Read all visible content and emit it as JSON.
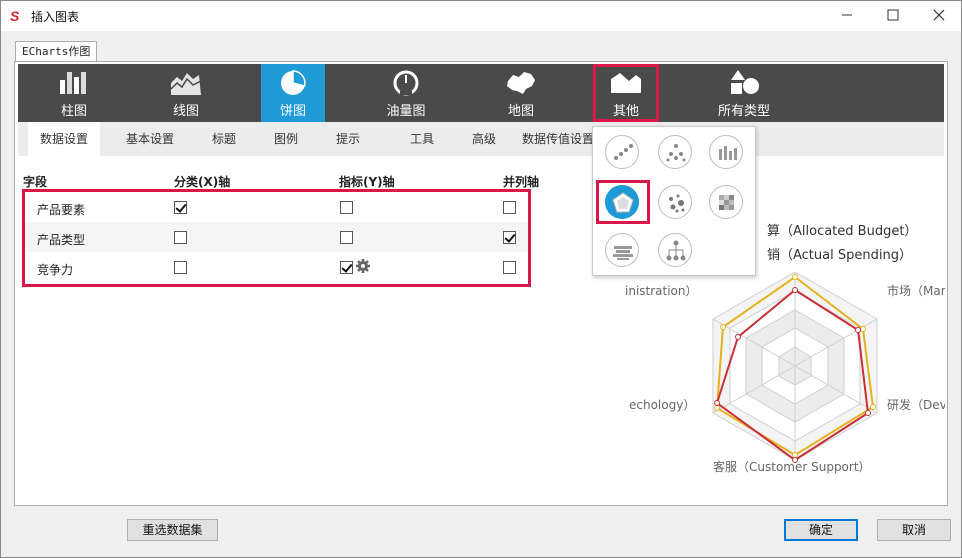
{
  "window": {
    "title": "插入图表"
  },
  "outer_tab": {
    "label": "ECharts作图"
  },
  "chart_types": [
    {
      "label": "柱图",
      "icon": "bar-chart-icon"
    },
    {
      "label": "线图",
      "icon": "line-chart-icon"
    },
    {
      "label": "饼图",
      "icon": "pie-chart-icon",
      "state": "active"
    },
    {
      "label": "油量图",
      "icon": "gauge-chart-icon"
    },
    {
      "label": "地图",
      "icon": "map-chart-icon"
    },
    {
      "label": "其他",
      "icon": "other-chart-icon",
      "state": "highlighted"
    },
    {
      "label": "所有类型",
      "icon": "all-types-icon"
    }
  ],
  "sub_tabs": [
    {
      "label": "数据设置",
      "state": "active"
    },
    {
      "label": "基本设置"
    },
    {
      "label": "标题"
    },
    {
      "label": "图例"
    },
    {
      "label": "提示"
    },
    {
      "label": "工具"
    },
    {
      "label": "高级"
    },
    {
      "label": "数据传值设置"
    }
  ],
  "fields_table": {
    "headers": {
      "field": "字段",
      "x_axis": "分类(X)轴",
      "y_axis": "指标(Y)轴",
      "parallel": "并列轴"
    },
    "rows": [
      {
        "name": "产品要素",
        "x": true,
        "y": false,
        "parallel": false
      },
      {
        "name": "产品类型",
        "x": false,
        "y": false,
        "parallel": true
      },
      {
        "name": "竞争力",
        "x": false,
        "y": true,
        "parallel": false,
        "y_settings_icon": "gear-icon"
      }
    ]
  },
  "other_chart_popup": {
    "items": [
      "scatter-icon",
      "funnel-icon",
      "candlestick-icon",
      "radar-icon",
      "bubble-icon",
      "heatmap-icon",
      "wordcloud-icon",
      "tree-icon"
    ],
    "selected": "radar-icon"
  },
  "radar_preview": {
    "legend": [
      "算（Allocated Budget）",
      "销（Actual Spending）"
    ],
    "indicators": {
      "top_right": "市场（Mark",
      "bottom_right": "研发（Deve",
      "bottom": "客服（Customer Support）",
      "bottom_left": "echology）",
      "top_left": "inistration）"
    },
    "colors": {
      "allocated": "#e3b21f",
      "actual": "#c92f37"
    }
  },
  "buttons": {
    "reselect": "重选数据集",
    "ok": "确定",
    "cancel": "取消"
  }
}
